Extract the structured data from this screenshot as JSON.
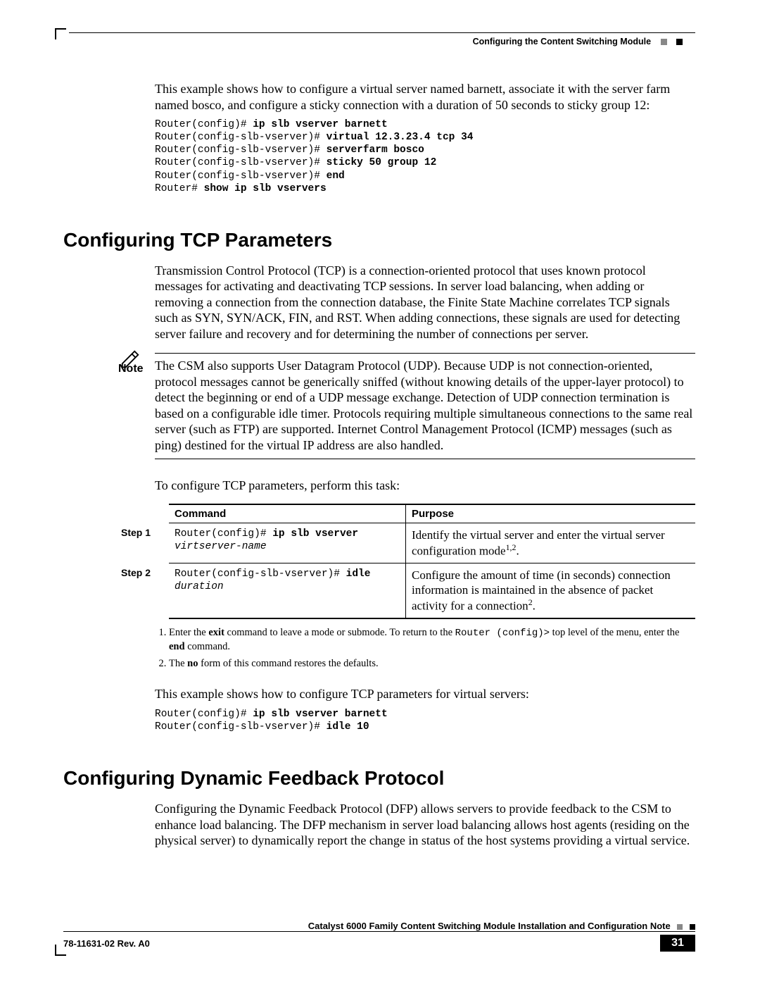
{
  "header": {
    "running_head": "Configuring the Content Switching Module"
  },
  "intro": {
    "p1": "This example shows how to configure a virtual server named barnett, associate it with the server farm named bosco, and configure a sticky connection with a duration of 50 seconds to sticky group 12:",
    "code_lines": [
      {
        "pre": "Router(config)# ",
        "cmd": "ip slb vserver barnett"
      },
      {
        "pre": "Router(config-slb-vserver)# ",
        "cmd": "virtual 12.3.23.4 tcp 34"
      },
      {
        "pre": "Router(config-slb-vserver)# ",
        "cmd": "serverfarm bosco"
      },
      {
        "pre": "Router(config-slb-vserver)# ",
        "cmd": "sticky 50 group 12"
      },
      {
        "pre": "Router(config-slb-vserver)# ",
        "cmd": "end"
      },
      {
        "pre": "Router# ",
        "cmd": "show ip slb vservers"
      }
    ]
  },
  "section1": {
    "heading": "Configuring TCP Parameters",
    "p1": "Transmission Control Protocol (TCP) is a connection-oriented protocol that uses known protocol messages for activating and deactivating TCP sessions. In server load balancing, when adding or removing a connection from the connection database, the Finite State Machine correlates TCP signals such as SYN, SYN/ACK, FIN, and RST. When adding connections, these signals are used for detecting server failure and recovery and for determining the number of connections per server.",
    "note_label": "Note",
    "note": "The CSM also supports User Datagram Protocol (UDP). Because UDP is not connection-oriented, protocol messages cannot be generically sniffed (without knowing details of the upper-layer protocol) to detect the beginning or end of a UDP message exchange. Detection of UDP connection termination is based on a configurable idle timer. Protocols requiring multiple simultaneous connections to the same real server (such as FTP) are supported. Internet Control Management Protocol (ICMP) messages (such as ping) destined for the virtual IP address are also handled.",
    "p2": "To configure TCP parameters, perform this task:",
    "table": {
      "head_command": "Command",
      "head_purpose": "Purpose",
      "rows": [
        {
          "step": "Step 1",
          "cmd_pre": "Router(config)# ",
          "cmd_bold": "ip slb vserver",
          "cmd_ital": "virtserver-name",
          "purpose": "Identify the virtual server and enter the virtual server configuration mode",
          "purpose_sup": "1,2",
          "purpose_tail": "."
        },
        {
          "step": "Step 2",
          "cmd_pre": "Router(config-slb-vserver)# ",
          "cmd_bold": "idle",
          "cmd_ital": "duration",
          "purpose": "Configure the amount of time (in seconds) connection information is maintained in the absence of packet activity for a connection",
          "purpose_sup": "2",
          "purpose_tail": "."
        }
      ]
    },
    "footnotes": {
      "f1a": "Enter the ",
      "f1b": "exit",
      "f1c": " command to leave a mode or submode. To return to the ",
      "f1d": "Router (config)>",
      "f1e": " top level of the menu, enter the ",
      "f1f": "end",
      "f1g": " command.",
      "f2a": "The ",
      "f2b": "no",
      "f2c": " form of this command restores the defaults."
    },
    "p3": "This example shows how to configure TCP parameters for virtual servers:",
    "code2_lines": [
      {
        "pre": "Router(config)# ",
        "cmd": "ip slb vserver barnett"
      },
      {
        "pre": "Router(config-slb-vserver)# ",
        "cmd": "idle 10"
      }
    ]
  },
  "section2": {
    "heading": "Configuring Dynamic Feedback Protocol",
    "p1": "Configuring the Dynamic Feedback Protocol (DFP) allows servers to provide feedback to the CSM to enhance load balancing. The DFP mechanism in server load balancing allows host agents (residing on the physical server) to dynamically report the change in status of the host systems providing a virtual service."
  },
  "footer": {
    "title": "Catalyst 6000 Family Content Switching Module Installation and Configuration Note",
    "docnum": "78-11631-02 Rev. A0",
    "page": "31"
  }
}
